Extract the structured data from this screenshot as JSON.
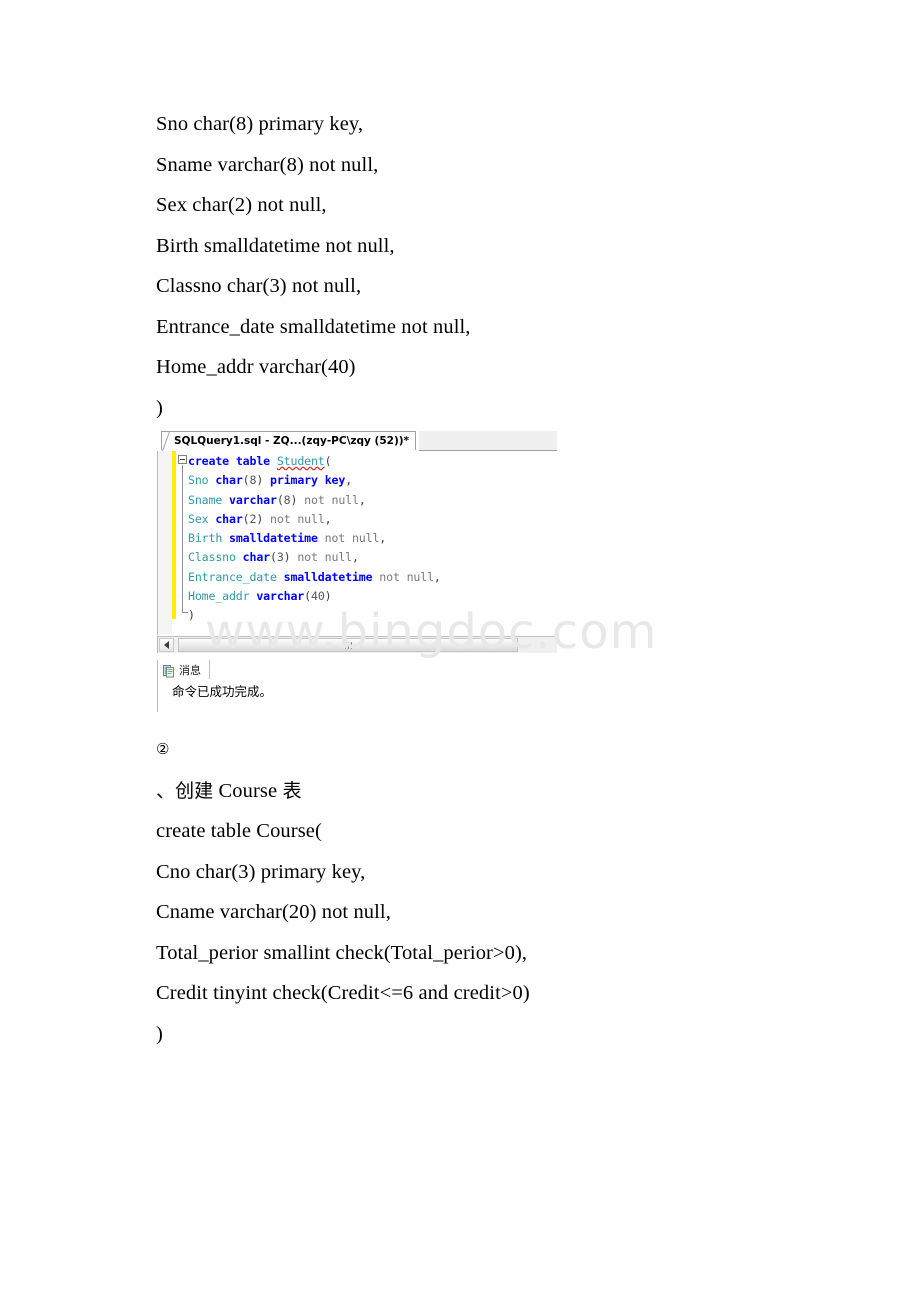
{
  "document": {
    "top_lines": [
      "Sno char(8) primary key,",
      "Sname varchar(8) not null,",
      "Sex char(2) not null,",
      "Birth smalldatetime not null,",
      "Classno char(3) not null,",
      "Entrance_date smalldatetime not null,",
      "Home_addr varchar(40)",
      ")"
    ],
    "bottom_lines": [
      "②",
      "、创建 Course 表",
      "create table Course(",
      "Cno char(3) primary key,",
      "Cname varchar(20) not null,",
      "Total_perior smallint check(Total_perior>0),",
      "Credit tinyint check(Credit<=6 and credit>0)",
      ")"
    ]
  },
  "watermark": {
    "text": "www.bingdoc.com",
    "color": "#e8e8e8"
  },
  "ssms": {
    "tab": {
      "title": "SQLQuery1.sql - ZQ...(zqy-PC\\zqy (52))*"
    },
    "editor": {
      "lines": [
        {
          "tokens": [
            {
              "text": "create",
              "style": "kw"
            },
            {
              "text": " ",
              "style": "plain"
            },
            {
              "text": "table",
              "style": "kw"
            },
            {
              "text": " ",
              "style": "plain"
            },
            {
              "text": "Student",
              "style": "sq"
            },
            {
              "text": "(",
              "style": "punc"
            }
          ]
        },
        {
          "tokens": [
            {
              "text": "Sno",
              "style": "ident"
            },
            {
              "text": " ",
              "style": "plain"
            },
            {
              "text": "char",
              "style": "kw"
            },
            {
              "text": "(",
              "style": "punc"
            },
            {
              "text": "8",
              "style": "num"
            },
            {
              "text": ") ",
              "style": "punc"
            },
            {
              "text": "primary",
              "style": "kw"
            },
            {
              "text": " ",
              "style": "plain"
            },
            {
              "text": "key",
              "style": "kw"
            },
            {
              "text": ",",
              "style": "punc"
            }
          ]
        },
        {
          "tokens": [
            {
              "text": "Sname",
              "style": "ident"
            },
            {
              "text": " ",
              "style": "plain"
            },
            {
              "text": "varchar",
              "style": "kw"
            },
            {
              "text": "(",
              "style": "punc"
            },
            {
              "text": "8",
              "style": "num"
            },
            {
              "text": ") ",
              "style": "punc"
            },
            {
              "text": "not null",
              "style": "plain"
            },
            {
              "text": ",",
              "style": "punc"
            }
          ]
        },
        {
          "tokens": [
            {
              "text": "Sex",
              "style": "ident"
            },
            {
              "text": " ",
              "style": "plain"
            },
            {
              "text": "char",
              "style": "kw"
            },
            {
              "text": "(",
              "style": "punc"
            },
            {
              "text": "2",
              "style": "num"
            },
            {
              "text": ") ",
              "style": "punc"
            },
            {
              "text": "not null",
              "style": "plain"
            },
            {
              "text": ",",
              "style": "punc"
            }
          ]
        },
        {
          "tokens": [
            {
              "text": "Birth",
              "style": "ident"
            },
            {
              "text": " ",
              "style": "plain"
            },
            {
              "text": "smalldatetime",
              "style": "kw"
            },
            {
              "text": " ",
              "style": "plain"
            },
            {
              "text": "not null",
              "style": "plain"
            },
            {
              "text": ",",
              "style": "punc"
            }
          ]
        },
        {
          "tokens": [
            {
              "text": "Classno",
              "style": "ident"
            },
            {
              "text": " ",
              "style": "plain"
            },
            {
              "text": "char",
              "style": "kw"
            },
            {
              "text": "(",
              "style": "punc"
            },
            {
              "text": "3",
              "style": "num"
            },
            {
              "text": ") ",
              "style": "punc"
            },
            {
              "text": "not null",
              "style": "plain"
            },
            {
              "text": ",",
              "style": "punc"
            }
          ]
        },
        {
          "tokens": [
            {
              "text": "Entrance_date",
              "style": "ident"
            },
            {
              "text": " ",
              "style": "plain"
            },
            {
              "text": "smalldatetime",
              "style": "kw"
            },
            {
              "text": " ",
              "style": "plain"
            },
            {
              "text": "not null",
              "style": "plain"
            },
            {
              "text": ",",
              "style": "punc"
            }
          ]
        },
        {
          "tokens": [
            {
              "text": "Home_addr",
              "style": "ident"
            },
            {
              "text": " ",
              "style": "plain"
            },
            {
              "text": "varchar",
              "style": "kw"
            },
            {
              "text": "(",
              "style": "punc"
            },
            {
              "text": "40",
              "style": "num"
            },
            {
              "text": ")",
              "style": "punc"
            }
          ]
        },
        {
          "tokens": [
            {
              "text": ")",
              "style": "punc"
            }
          ]
        }
      ]
    },
    "results": {
      "tab_label": "消息",
      "message": "命令已成功完成。"
    }
  },
  "colors": {
    "keyword": "#0000ff",
    "identifier": "#2e9ba4",
    "plain_text": "#7a7a7a",
    "change_bar": "#ffee00",
    "squiggly": "#e02020"
  }
}
